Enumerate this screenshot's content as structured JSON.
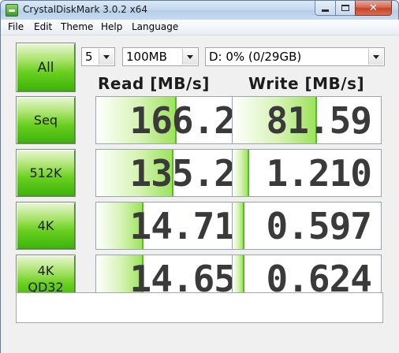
{
  "window": {
    "title": "CrystalDiskMark 3.0.2 x64",
    "close_glyph": "✕"
  },
  "menu": {
    "items": [
      "File",
      "Edit",
      "Theme",
      "Help",
      "Language"
    ]
  },
  "controls": {
    "all_label": "All",
    "test_count": "5",
    "test_size": "100MB",
    "drive": "D: 0% (0/29GB)"
  },
  "columns": {
    "read": "Read [MB/s]",
    "write": "Write [MB/s]"
  },
  "rows": [
    {
      "line1": "Seq",
      "line2": "",
      "read": "166.2",
      "write": "81.59",
      "read_bar_fraction": 0.54,
      "write_bar_fraction": 0.57
    },
    {
      "line1": "512K",
      "line2": "",
      "read": "135.2",
      "write": "1.210",
      "read_bar_fraction": 0.52,
      "write_bar_fraction": 0.11
    },
    {
      "line1": "4K",
      "line2": "",
      "read": "14.71",
      "write": "0.597",
      "read_bar_fraction": 0.32,
      "write_bar_fraction": 0.08
    },
    {
      "line1": "4K",
      "line2": "QD32",
      "read": "14.65",
      "write": "0.624",
      "read_bar_fraction": 0.32,
      "write_bar_fraction": 0.08
    }
  ],
  "comment": "",
  "colors": {
    "button_green": "#6ad020",
    "bar_green": "#9ee35e",
    "value_text": "#3a3a3a"
  }
}
